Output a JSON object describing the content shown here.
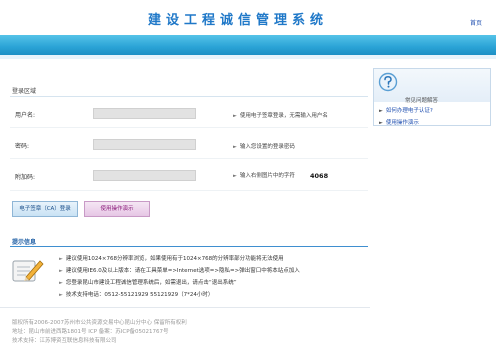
{
  "header": {
    "title": "建设工程诚信管理系统",
    "home_link": "首页"
  },
  "login": {
    "section_title": "登录区域",
    "username_label": "用户名:",
    "username_hint": "使用电子签章登录，无需输入用户名",
    "password_label": "密码:",
    "password_hint": "输入您设置的登录密码",
    "captcha_label": "附加码:",
    "captcha_hint": "输入右侧图片中的字符",
    "captcha_value": "4068",
    "cert_login_button": "电子签章（CA）登录",
    "manual_button": "使用操作演示"
  },
  "tips": {
    "title": "提示信息",
    "items": [
      "建议使用1024×768分辨率浏览，如果使用有于1024×768的分辨率部分功能将无法使用",
      "建议使用IE6.0及以上版本：请在工具菜单=>Internet选项=>隐私=>弹出窗口中将本站点加入",
      "您登录昆山市建设工程诚信管理系统后，如需退出，请点击“退出系统”",
      "技术支持电话：0512-55121929 55121929（7*24小时）"
    ]
  },
  "footer": {
    "line1": "版权所有2006-2007苏州市公共资源交易中心昆山分中心 保留所有权利",
    "line2": "地址：昆山市前进西路1801号 ICP 备案：苏ICP备05021767号",
    "line3": "技术支持：江苏博资互联信息科技有限公司"
  },
  "sidebar": {
    "title": "常见问题解答",
    "links": [
      "如何办理电子认证?",
      "使用操作演示"
    ]
  },
  "colors": {
    "banner": "#2aa3d6",
    "title_blue": "#1f78c8",
    "link_blue": "#1f4fb0"
  }
}
